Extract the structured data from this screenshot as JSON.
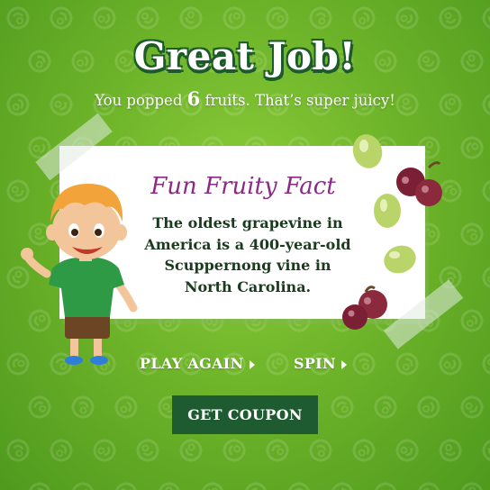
{
  "header": {
    "title": "Great Job!",
    "subtitle_prefix": "You popped",
    "fruit_count": "6",
    "subtitle_suffix": "fruits. That’s super juicy!"
  },
  "fact_card": {
    "heading": "Fun Fruity Fact",
    "lines": [
      "The oldest grapevine in",
      "America is a 400-year-old",
      "Scuppernong vine in",
      "North Carolina."
    ]
  },
  "actions": {
    "play_again": "PLAY AGAIN",
    "spin": "SPIN",
    "coupon": "GET COUPON"
  },
  "colors": {
    "background": "#6fb52a",
    "title_outline": "#1d5a2a",
    "heading": "#8a2a86",
    "body_text": "#1b3b1e",
    "button": "#1f5b31"
  },
  "icons": {
    "background_pattern": "fruit-doodle-icon",
    "link_arrow": "play-triangle-icon"
  }
}
